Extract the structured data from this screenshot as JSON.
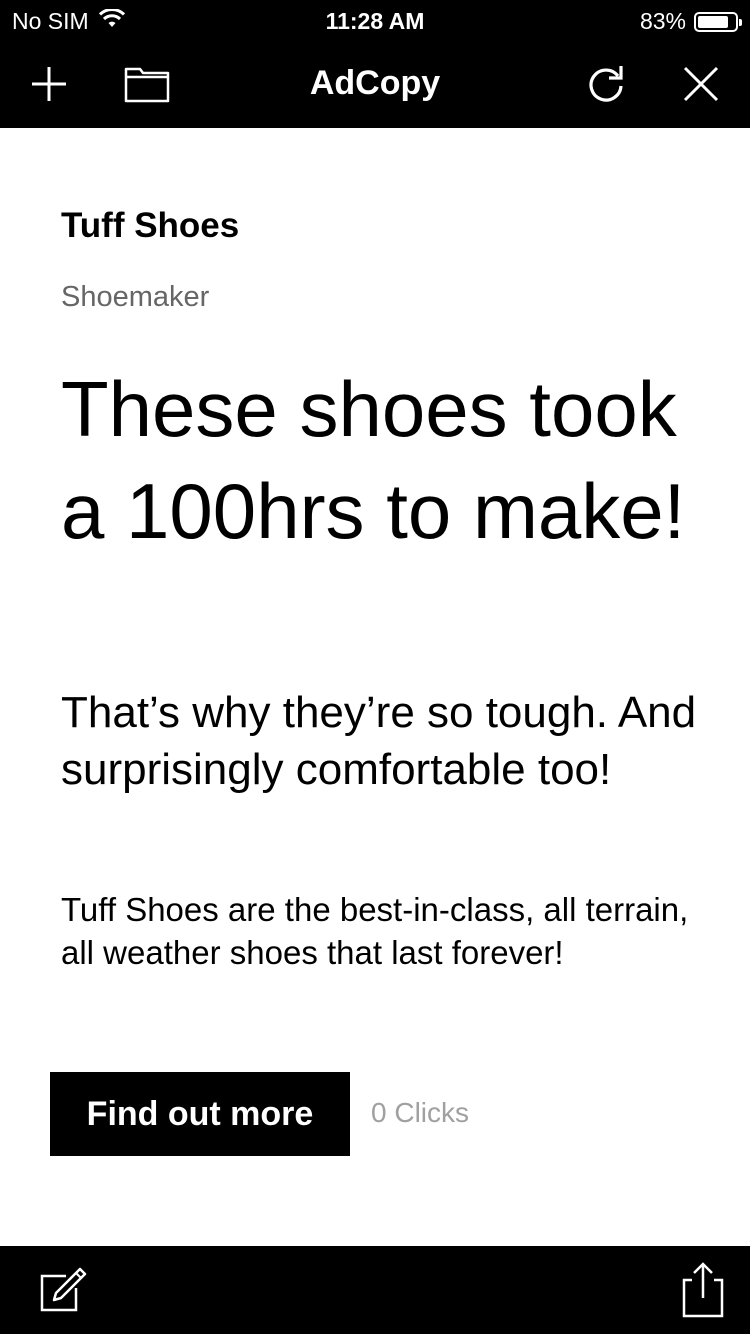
{
  "status_bar": {
    "carrier": "No SIM",
    "time": "11:28 AM",
    "battery_text": "83%",
    "battery_level": 0.83
  },
  "nav": {
    "title": "AdCopy",
    "icons": {
      "left": [
        "plus-icon",
        "folder-icon"
      ],
      "right": [
        "refresh-icon",
        "close-icon"
      ]
    }
  },
  "ad": {
    "brand": "Tuff Shoes",
    "category": "Shoemaker",
    "headline": "These shoes took a 100hrs to make!",
    "subheadline": "That’s why they’re so tough. And surprisingly comfortable too!",
    "body": "Tuff Shoes are the best-in-class, all terrain, all weather shoes that last forever!",
    "cta_label": "Find out more",
    "clicks_text": "0 Clicks"
  },
  "bottom_bar": {
    "icons": [
      "compose-icon",
      "share-icon"
    ]
  },
  "colors": {
    "bar_background": "#000000",
    "page_background": "#ffffff",
    "muted_text": "#666666",
    "clicks_text": "#a0a0a0"
  }
}
